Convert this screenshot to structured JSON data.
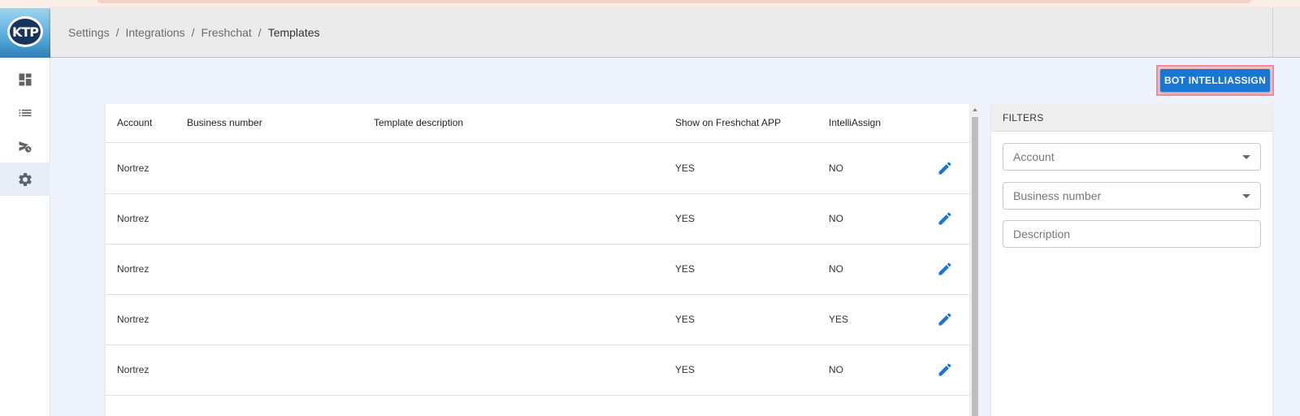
{
  "breadcrumb": [
    "Settings",
    "Integrations",
    "Freshchat",
    "Templates"
  ],
  "logo_text": "KTP",
  "nav": [
    {
      "icon": "dashboard-icon"
    },
    {
      "icon": "list-icon"
    },
    {
      "icon": "scheduled-send-icon"
    },
    {
      "icon": "settings-gear-icon",
      "active": true
    }
  ],
  "action_button": "BOT INTELLIASSIGN",
  "table": {
    "columns": [
      "Account",
      "Business number",
      "Template description",
      "Show on Freshchat APP",
      "IntelliAssign"
    ],
    "rows": [
      {
        "account": "Nortrez",
        "business_number": "",
        "description": "",
        "show_on_app": "YES",
        "intelliassign": "NO"
      },
      {
        "account": "Nortrez",
        "business_number": "",
        "description": "",
        "show_on_app": "YES",
        "intelliassign": "NO"
      },
      {
        "account": "Nortrez",
        "business_number": "",
        "description": "",
        "show_on_app": "YES",
        "intelliassign": "NO"
      },
      {
        "account": "Nortrez",
        "business_number": "",
        "description": "",
        "show_on_app": "YES",
        "intelliassign": "YES"
      },
      {
        "account": "Nortrez",
        "business_number": "",
        "description": "",
        "show_on_app": "YES",
        "intelliassign": "NO"
      }
    ]
  },
  "filters": {
    "title": "FILTERS",
    "account_placeholder": "Account",
    "business_number_placeholder": "Business number",
    "description_placeholder": "Description"
  },
  "colors": {
    "accent": "#1976d2",
    "highlight_border": "#f08a96"
  }
}
